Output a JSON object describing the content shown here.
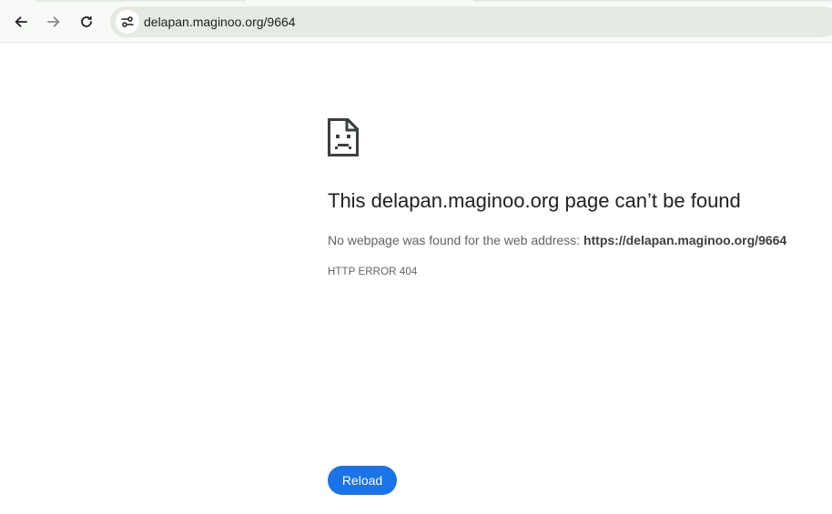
{
  "browser": {
    "url": "delapan.maginoo.org/9664",
    "back_icon": "arrow-left-icon",
    "forward_icon": "arrow-right-icon",
    "reload_icon": "refresh-icon",
    "site_info_icon": "tune-icon"
  },
  "error_page": {
    "icon": "sad-document-icon",
    "heading": "This delapan.maginoo.org page can’t be found",
    "description_prefix": "No webpage was found for the web address: ",
    "description_url": "https://delapan.maginoo.org/9664",
    "error_code": "HTTP ERROR 404",
    "reload_label": "Reload"
  },
  "colors": {
    "toolbar_bg": "#f7faf6",
    "omnibox_bg": "#e5ebe2",
    "button_blue": "#1a73e8",
    "heading_text": "#202124",
    "body_text": "#5f6368"
  }
}
